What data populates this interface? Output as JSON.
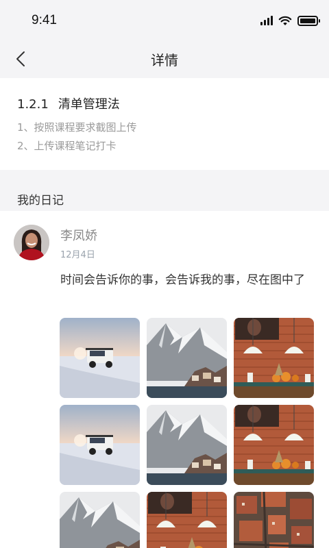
{
  "status": {
    "time": "9:41"
  },
  "nav": {
    "title": "详情"
  },
  "task": {
    "number": "1.2.1",
    "name": "清单管理法",
    "requirements": [
      "1、按照课程要求截图上传",
      "2、上传课程笔记打卡"
    ]
  },
  "section": {
    "title": "我的日记"
  },
  "diary": {
    "author": "李凤娇",
    "date": "12月4日",
    "content": "时间会告诉你的事，会告诉我的事，尽在图中了",
    "images": [
      "jeep-snow",
      "mountain-village",
      "brick-cafe",
      "jeep-snow",
      "mountain-village",
      "brick-cafe",
      "mountain-village",
      "brick-cafe",
      "aerial-city"
    ]
  }
}
